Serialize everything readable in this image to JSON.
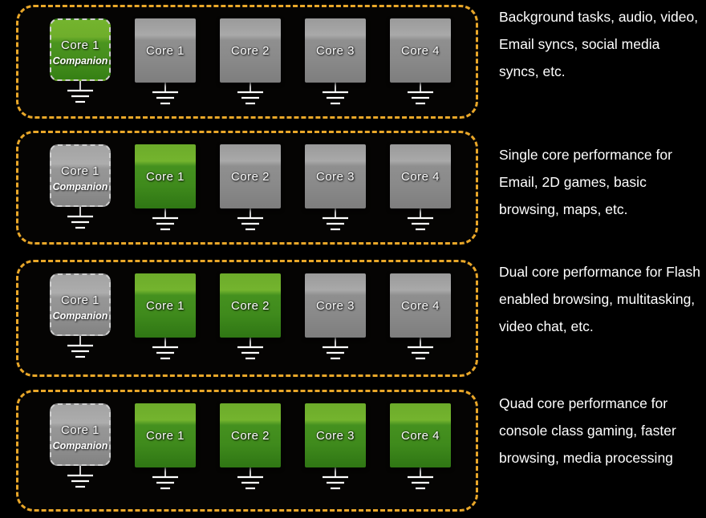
{
  "rows": [
    {
      "id": "row-background-tasks",
      "cores": [
        {
          "label": "Core 1",
          "sub": "Companion",
          "state": "active",
          "type": "companion"
        },
        {
          "label": "Core 1",
          "sub": "",
          "state": "inactive",
          "type": "normal"
        },
        {
          "label": "Core 2",
          "sub": "",
          "state": "inactive",
          "type": "normal"
        },
        {
          "label": "Core 3",
          "sub": "",
          "state": "inactive",
          "type": "normal"
        },
        {
          "label": "Core 4",
          "sub": "",
          "state": "inactive",
          "type": "normal"
        }
      ],
      "caption": " Background tasks, audio, video, Email syncs, social media syncs, etc."
    },
    {
      "id": "row-single-core",
      "cores": [
        {
          "label": "Core 1",
          "sub": "Companion",
          "state": "inactive",
          "type": "companion"
        },
        {
          "label": "Core 1",
          "sub": "",
          "state": "active",
          "type": "normal"
        },
        {
          "label": "Core 2",
          "sub": "",
          "state": "inactive",
          "type": "normal"
        },
        {
          "label": "Core 3",
          "sub": "",
          "state": "inactive",
          "type": "normal"
        },
        {
          "label": "Core 4",
          "sub": "",
          "state": "inactive",
          "type": "normal"
        }
      ],
      "caption": " Single core performance for Email, 2D games, basic browsing, maps, etc."
    },
    {
      "id": "row-dual-core",
      "cores": [
        {
          "label": "Core 1",
          "sub": "Companion",
          "state": "inactive",
          "type": "companion"
        },
        {
          "label": "Core 1",
          "sub": "",
          "state": "active",
          "type": "normal"
        },
        {
          "label": "Core 2",
          "sub": "",
          "state": "active",
          "type": "normal"
        },
        {
          "label": "Core 3",
          "sub": "",
          "state": "inactive",
          "type": "normal"
        },
        {
          "label": "Core 4",
          "sub": "",
          "state": "inactive",
          "type": "normal"
        }
      ],
      "caption": "Dual core performance for Flash enabled browsing, multitasking, video chat, etc."
    },
    {
      "id": "row-quad-core",
      "cores": [
        {
          "label": "Core 1",
          "sub": "Companion",
          "state": "inactive",
          "type": "companion"
        },
        {
          "label": "Core 1",
          "sub": "",
          "state": "active",
          "type": "normal"
        },
        {
          "label": "Core 2",
          "sub": "",
          "state": "active",
          "type": "normal"
        },
        {
          "label": "Core 3",
          "sub": "",
          "state": "active",
          "type": "normal"
        },
        {
          "label": "Core 4",
          "sub": "",
          "state": "active",
          "type": "normal"
        }
      ],
      "caption": "Quad core performance for console class gaming, faster browsing, media processing"
    }
  ],
  "colors": {
    "background": "#000000",
    "group_border": "#e9a729",
    "active_core": "#4a9620",
    "inactive_core": "#949494",
    "text": "#ffffff"
  },
  "icons": {
    "ground": "ground-symbol"
  }
}
